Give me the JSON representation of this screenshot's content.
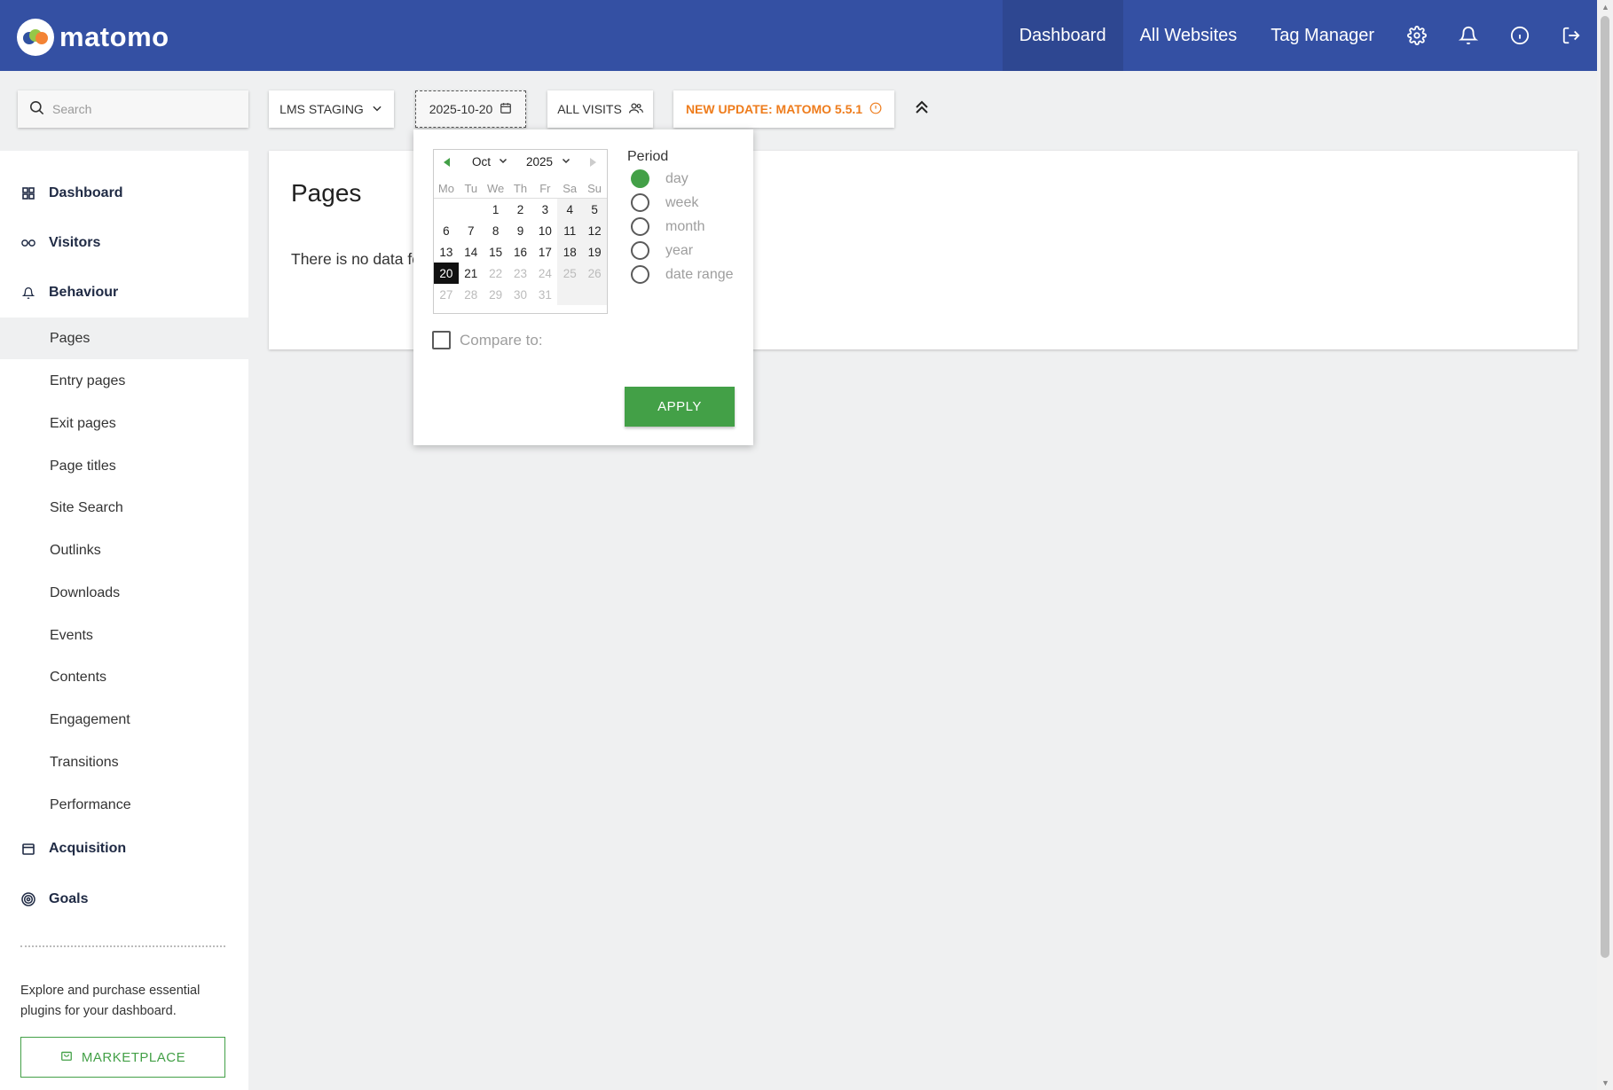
{
  "app": {
    "name": "matomo"
  },
  "topnav": {
    "links": [
      "Dashboard",
      "All Websites",
      "Tag Manager"
    ],
    "icons": [
      "gear-icon",
      "bell-icon",
      "info-icon",
      "logout-icon"
    ]
  },
  "controls": {
    "search_placeholder": "Search",
    "site": "LMS STAGING",
    "date": "2025-10-20",
    "segment": "ALL VISITS",
    "update": "NEW UPDATE: MATOMO 5.5.1"
  },
  "sidebar": {
    "categories": {
      "dashboard": "Dashboard",
      "visitors": "Visitors",
      "behaviour": "Behaviour",
      "acquisition": "Acquisition",
      "goals": "Goals"
    },
    "behaviour_items": [
      "Pages",
      "Entry pages",
      "Exit pages",
      "Page titles",
      "Site Search",
      "Outlinks",
      "Downloads",
      "Events",
      "Contents",
      "Engagement",
      "Transitions",
      "Performance"
    ],
    "active_item": "Pages",
    "promo": "Explore and purchase essential plugins for your dashboard.",
    "marketplace": "MARKETPLACE"
  },
  "main": {
    "title": "Pages",
    "body": "There is no data fo"
  },
  "datepicker": {
    "month": "Oct",
    "year": "2025",
    "weekdays": [
      "Mo",
      "Tu",
      "We",
      "Th",
      "Fr",
      "Sa",
      "Su"
    ],
    "weeks": [
      [
        "",
        "",
        "1",
        "2",
        "3",
        "4",
        "5"
      ],
      [
        "6",
        "7",
        "8",
        "9",
        "10",
        "11",
        "12"
      ],
      [
        "13",
        "14",
        "15",
        "16",
        "17",
        "18",
        "19"
      ],
      [
        "20",
        "21",
        "22",
        "23",
        "24",
        "25",
        "26"
      ],
      [
        "27",
        "28",
        "29",
        "30",
        "31",
        "",
        ""
      ]
    ],
    "selected_day": "20",
    "last_enabled_day": 21,
    "period_title": "Period",
    "periods": [
      "day",
      "week",
      "month",
      "year",
      "date range"
    ],
    "selected_period": "day",
    "compare_label": "Compare to:",
    "apply": "APPLY"
  },
  "colors": {
    "topbar": "#3450a3",
    "accent_green": "#43a047",
    "update_orange": "#ee7c1c"
  }
}
